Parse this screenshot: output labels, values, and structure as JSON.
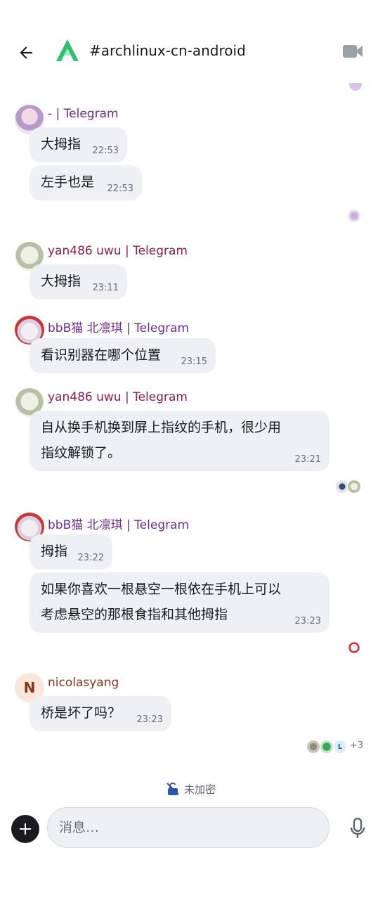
{
  "header": {
    "room_name": "#archlinux-cn-android",
    "back_icon": "back-arrow-icon",
    "video_icon": "video-call-icon",
    "room_logo_color": "#2fbf71"
  },
  "colors": {
    "sender_purple": "#6b2e8c",
    "sender_maroon": "#8a1c4d",
    "sender_brown": "#8a3416",
    "bubble_bg": "#eff0f4"
  },
  "messages": [
    {
      "sender": "- | Telegram",
      "text": "大拇指",
      "time": "22:53"
    },
    {
      "text": "左手也是",
      "time": "22:53"
    },
    {
      "sender": "yan486 uwu | Telegram",
      "text": "大拇指",
      "time": "23:11"
    },
    {
      "sender": "bbB猫 北凛琪 | Telegram",
      "text": "看识别器在哪个位置",
      "time": "23:15"
    },
    {
      "sender": "yan486 uwu | Telegram",
      "text_line1": "自从换手机换到屏上指纹的手机，很少用",
      "text_line2": "指纹解锁了。",
      "time": "23:21"
    },
    {
      "sender": "bbB猫 北凛琪 | Telegram",
      "text": "拇指",
      "time": "23:22"
    },
    {
      "text_line1": "如果你喜欢一根悬空一根依在手机上可以",
      "text_line2": "考虑悬空的那根食指和其他拇指",
      "time": "23:23"
    },
    {
      "sender": "nicolasyang",
      "avatar_initial": "N",
      "text": "桥是坏了吗？",
      "time": "23:23"
    }
  ],
  "read_receipts": {
    "last_extra": "+3",
    "avatar_initial": "L"
  },
  "footer": {
    "encryption_label": "未加密",
    "composer_placeholder": "消息…"
  }
}
